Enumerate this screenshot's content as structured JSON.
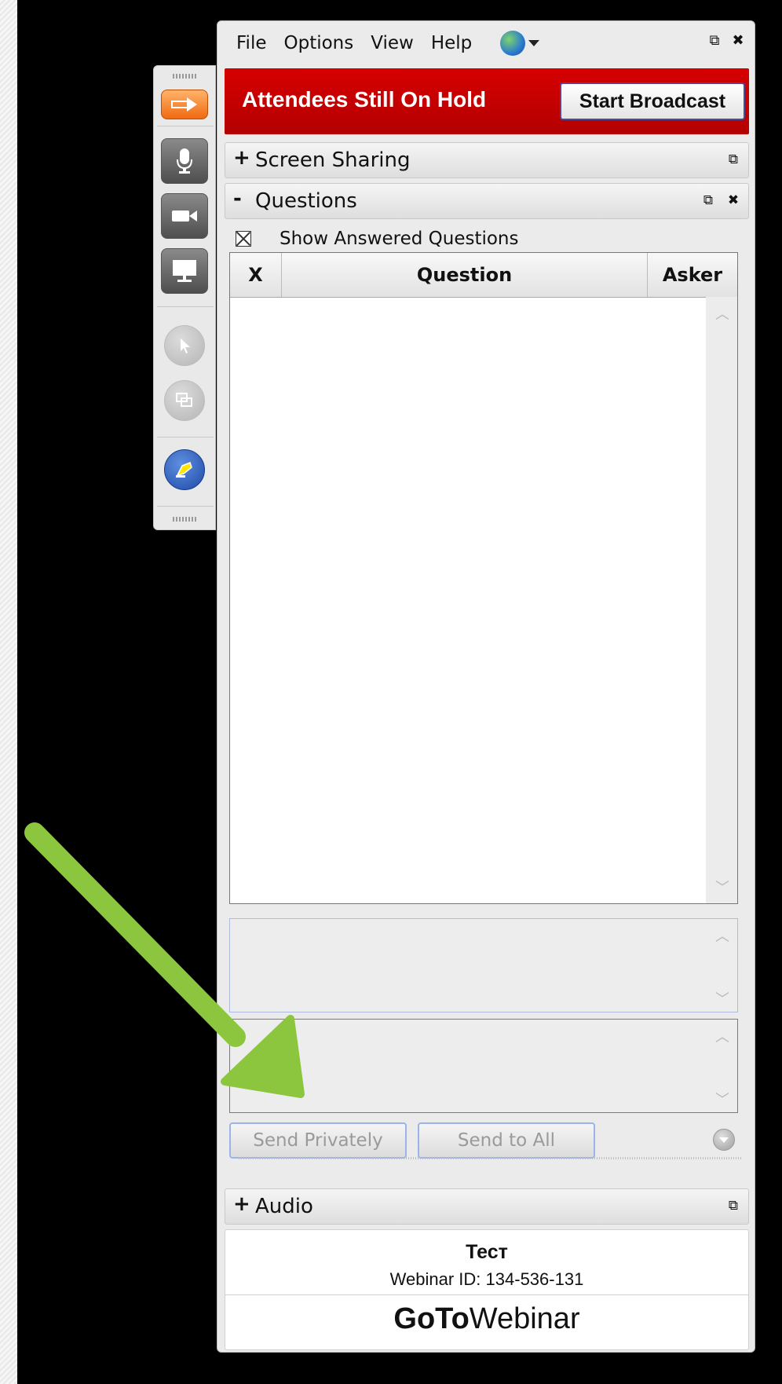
{
  "menu": {
    "items": [
      "File",
      "Options",
      "View",
      "Help"
    ]
  },
  "broadcast": {
    "status": "Attendees Still On Hold",
    "button": "Start Broadcast"
  },
  "sections": {
    "screen_sharing": {
      "sign": "+",
      "title": "Screen Sharing"
    },
    "questions": {
      "sign": "-",
      "title": "Questions"
    },
    "audio": {
      "sign": "+",
      "title": "Audio"
    }
  },
  "questions_panel": {
    "show_answered_label": "Show Answered Questions",
    "columns": {
      "x": "X",
      "question": "Question",
      "asker": "Asker"
    },
    "send_privately": "Send Privately",
    "send_to_all": "Send to All"
  },
  "webinar": {
    "name": "Тест",
    "id_line": "Webinar ID: 134-536-131",
    "logo_bold": "GoTo",
    "logo_regular": "Webinar"
  },
  "icons": {
    "toolbar": [
      "arrow-right-icon",
      "microphone-icon",
      "webcam-icon",
      "screen-icon",
      "cursor-icon",
      "screens-icon",
      "highlighter-icon"
    ],
    "window": [
      "popout-icon",
      "close-icon"
    ],
    "globe": "globe-icon"
  },
  "colors": {
    "accent_red": "#c80000",
    "annotation_arrow": "#8cc63f"
  }
}
